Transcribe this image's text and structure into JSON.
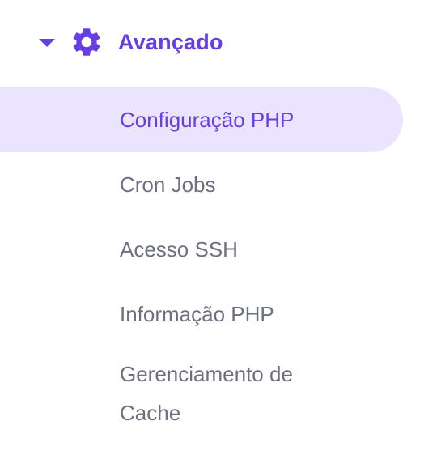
{
  "section": {
    "title": "Avançado",
    "icon": "gear-icon",
    "expanded": true,
    "accent_color": "#673de6"
  },
  "menu": {
    "items": [
      {
        "label": "Configuração PHP",
        "active": true
      },
      {
        "label": "Cron Jobs",
        "active": false
      },
      {
        "label": "Acesso SSH",
        "active": false
      },
      {
        "label": "Informação PHP",
        "active": false
      },
      {
        "label": "Gerenciamento de Cache",
        "active": false
      }
    ]
  },
  "colors": {
    "accent": "#673de6",
    "active_background": "#ebe4ff",
    "text_muted": "#6d7081"
  }
}
